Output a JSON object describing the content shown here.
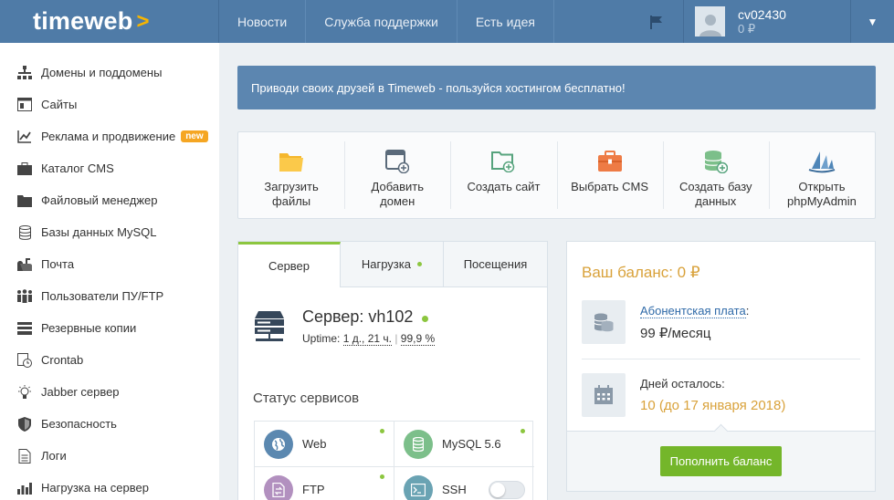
{
  "header": {
    "logo_text": "timeweb",
    "logo_mark": ">",
    "nav": [
      "Новости",
      "Служба поддержки",
      "Есть идея"
    ],
    "user": {
      "name": "cv02430",
      "balance": "0 ₽"
    }
  },
  "sidebar": {
    "items": [
      {
        "label": "Домены и поддомены",
        "icon": "domains-icon"
      },
      {
        "label": "Сайты",
        "icon": "sites-icon"
      },
      {
        "label": "Реклама и продвижение",
        "icon": "chart-icon",
        "badge": "new"
      },
      {
        "label": "Каталог CMS",
        "icon": "briefcase-icon"
      },
      {
        "label": "Файловый менеджер",
        "icon": "folder-icon"
      },
      {
        "label": "Базы данных MySQL",
        "icon": "database-icon"
      },
      {
        "label": "Почта",
        "icon": "mailbox-icon"
      },
      {
        "label": "Пользователи ПУ/FTP",
        "icon": "users-icon"
      },
      {
        "label": "Резервные копии",
        "icon": "backup-icon"
      },
      {
        "label": "Crontab",
        "icon": "clock-icon"
      },
      {
        "label": "Jabber сервер",
        "icon": "bulb-icon"
      },
      {
        "label": "Безопасность",
        "icon": "shield-icon"
      },
      {
        "label": "Логи",
        "icon": "document-icon"
      },
      {
        "label": "Нагрузка на сервер",
        "icon": "bar-chart-icon"
      }
    ]
  },
  "promo": {
    "text": "Приводи своих друзей в Timeweb - пользуйся хостингом бесплатно!"
  },
  "quick_actions": [
    {
      "line1": "Загрузить",
      "line2": "файлы",
      "icon": "upload-folder-icon"
    },
    {
      "line1": "Добавить",
      "line2": "домен",
      "icon": "add-domain-icon"
    },
    {
      "line1": "Создать сайт",
      "line2": "",
      "icon": "create-site-icon"
    },
    {
      "line1": "Выбрать CMS",
      "line2": "",
      "icon": "cms-icon"
    },
    {
      "line1": "Создать базу",
      "line2": "данных",
      "icon": "create-db-icon"
    },
    {
      "line1": "Открыть",
      "line2": "phpMyAdmin",
      "icon": "phpmyadmin-icon"
    }
  ],
  "server_panel": {
    "tabs": [
      "Сервер",
      "Нагрузка",
      "Посещения"
    ],
    "server_name": "Сервер: vh102",
    "uptime_label": "Uptime:",
    "uptime_value": "1 д., 21 ч.",
    "uptime_percent": "99,9 %",
    "services_title": "Статус сервисов",
    "services": [
      {
        "name": "Web",
        "icon": "globe-icon",
        "status": "on"
      },
      {
        "name": "MySQL 5.6",
        "icon": "database-icon",
        "status": "on"
      },
      {
        "name": "FTP",
        "icon": "ftp-icon",
        "status": "on"
      },
      {
        "name": "SSH",
        "icon": "terminal-icon",
        "status": "off"
      }
    ]
  },
  "balance_panel": {
    "title": "Ваш баланс: 0 ₽",
    "fee_label": "Абонентская плата",
    "fee_value": "99 ₽/месяц",
    "days_label": "Дней осталось:",
    "days_value": "10 (до 17 января 2018)",
    "topup_button": "Пополнить баланс"
  },
  "colors": {
    "header": "#4f7ba7",
    "promo": "#5c86b0",
    "accent_green": "#8cc63f",
    "button_green": "#74b62a",
    "accent_orange": "#d9a23b"
  }
}
